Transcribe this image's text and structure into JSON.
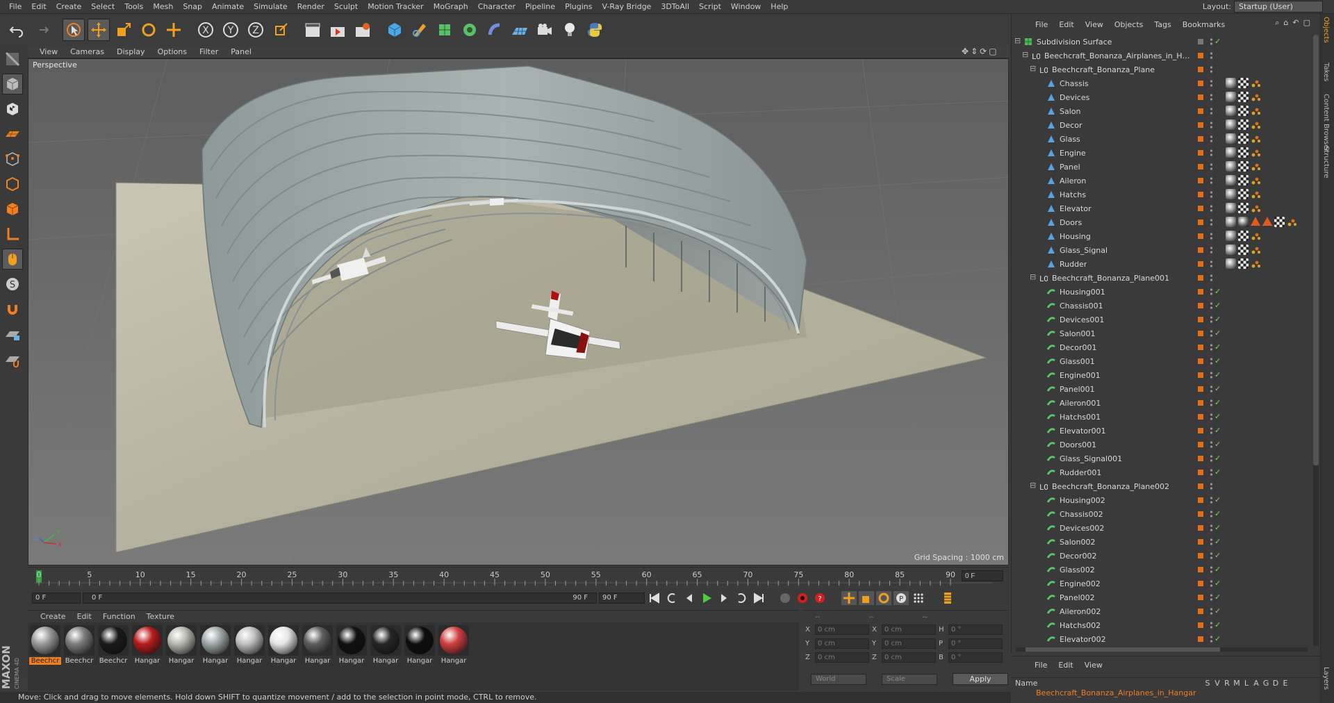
{
  "menu": [
    "File",
    "Edit",
    "Create",
    "Select",
    "Tools",
    "Mesh",
    "Snap",
    "Animate",
    "Simulate",
    "Render",
    "Sculpt",
    "Motion Tracker",
    "MoGraph",
    "Character",
    "Pipeline",
    "Plugins",
    "V-Ray Bridge",
    "3DToAll",
    "Script",
    "Window",
    "Help"
  ],
  "layout": {
    "label": "Layout:",
    "value": "Startup (User)"
  },
  "viewport": {
    "menu": [
      "View",
      "Cameras",
      "Display",
      "Options",
      "Filter",
      "Panel"
    ],
    "label": "Perspective",
    "grid_spacing": "Grid Spacing : 1000 cm"
  },
  "timeline": {
    "ticks": [
      "0",
      "5",
      "10",
      "15",
      "20",
      "25",
      "30",
      "35",
      "40",
      "45",
      "50",
      "55",
      "60",
      "65",
      "70",
      "75",
      "80",
      "85",
      "90"
    ],
    "current_frame": "0 F",
    "start": "0 F",
    "range_start": "0 F",
    "range_end": "90 F",
    "end": "90 F",
    "right_frame": "0 F"
  },
  "material_menu": [
    "Create",
    "Edit",
    "Function",
    "Texture"
  ],
  "materials": [
    {
      "label": "Beechcr",
      "color": "#9a9a9a",
      "selected": true
    },
    {
      "label": "Beechcr",
      "color": "#7d7d7d",
      "selected": false
    },
    {
      "label": "Beechcr",
      "color": "#1a1a1a",
      "selected": false
    },
    {
      "label": "Hangar",
      "color": "#b81c1c",
      "selected": false
    },
    {
      "label": "Hangar",
      "color": "#b8b8b0",
      "selected": false
    },
    {
      "label": "Hangar",
      "color": "#9fa8a8",
      "selected": false
    },
    {
      "label": "Hangar",
      "color": "#c0c0c0",
      "selected": false
    },
    {
      "label": "Hangar",
      "color": "#e6e6e6",
      "selected": false
    },
    {
      "label": "Hangar",
      "color": "#5e5e5e",
      "selected": false
    },
    {
      "label": "Hangar",
      "color": "#111111",
      "selected": false
    },
    {
      "label": "Hangar",
      "color": "#262626",
      "selected": false
    },
    {
      "label": "Hangar",
      "color": "#0d0d0d",
      "selected": false
    },
    {
      "label": "Hangar",
      "color": "#d04040",
      "selected": false
    }
  ],
  "coords": {
    "header": [
      "--",
      "--",
      "--"
    ],
    "rows": [
      {
        "a": "X",
        "av": "0 cm",
        "b": "X",
        "bv": "0 cm",
        "c": "H",
        "cv": "0 °"
      },
      {
        "a": "Y",
        "av": "0 cm",
        "b": "Y",
        "bv": "0 cm",
        "c": "P",
        "cv": "0 °"
      },
      {
        "a": "Z",
        "av": "0 cm",
        "b": "Z",
        "bv": "0 cm",
        "c": "B",
        "cv": "0 °"
      }
    ],
    "space": "World",
    "mode": "Scale",
    "apply": "Apply"
  },
  "status": "Move: Click and drag to move elements. Hold down SHIFT to quantize movement / add to the selection in point mode, CTRL to remove.",
  "object_menu": [
    "File",
    "Edit",
    "View",
    "Objects",
    "Tags",
    "Bookmarks"
  ],
  "objects": [
    {
      "name": "Subdivision Surface",
      "depth": 0,
      "kind": "sds"
    },
    {
      "name": "Beechcraft_Bonanza_Airplanes_in_Hangar",
      "depth": 1,
      "kind": "null"
    },
    {
      "name": "Beechcraft_Bonanza_Plane",
      "depth": 2,
      "kind": "null"
    },
    {
      "name": "Chassis",
      "depth": 3,
      "kind": "poly",
      "tags": 1
    },
    {
      "name": "Devices",
      "depth": 3,
      "kind": "poly",
      "tags": 1
    },
    {
      "name": "Salon",
      "depth": 3,
      "kind": "poly",
      "tags": 1
    },
    {
      "name": "Decor",
      "depth": 3,
      "kind": "poly",
      "tags": 1
    },
    {
      "name": "Glass",
      "depth": 3,
      "kind": "poly",
      "tags": 1
    },
    {
      "name": "Engine",
      "depth": 3,
      "kind": "poly",
      "tags": 1
    },
    {
      "name": "Panel",
      "depth": 3,
      "kind": "poly",
      "tags": 1
    },
    {
      "name": "Aileron",
      "depth": 3,
      "kind": "poly",
      "tags": 1
    },
    {
      "name": "Hatchs",
      "depth": 3,
      "kind": "poly",
      "tags": 1
    },
    {
      "name": "Elevator",
      "depth": 3,
      "kind": "poly",
      "tags": 1
    },
    {
      "name": "Doors",
      "depth": 3,
      "kind": "poly",
      "tags": 2
    },
    {
      "name": "Housing",
      "depth": 3,
      "kind": "poly",
      "tags": 1
    },
    {
      "name": "Glass_Signal",
      "depth": 3,
      "kind": "poly",
      "tags": 1
    },
    {
      "name": "Rudder",
      "depth": 3,
      "kind": "poly",
      "tags": 1
    },
    {
      "name": "Beechcraft_Bonanza_Plane001",
      "depth": 2,
      "kind": "null"
    },
    {
      "name": "Housing001",
      "depth": 3,
      "kind": "inst"
    },
    {
      "name": "Chassis001",
      "depth": 3,
      "kind": "inst"
    },
    {
      "name": "Devices001",
      "depth": 3,
      "kind": "inst"
    },
    {
      "name": "Salon001",
      "depth": 3,
      "kind": "inst"
    },
    {
      "name": "Decor001",
      "depth": 3,
      "kind": "inst"
    },
    {
      "name": "Glass001",
      "depth": 3,
      "kind": "inst"
    },
    {
      "name": "Engine001",
      "depth": 3,
      "kind": "inst"
    },
    {
      "name": "Panel001",
      "depth": 3,
      "kind": "inst"
    },
    {
      "name": "Aileron001",
      "depth": 3,
      "kind": "inst"
    },
    {
      "name": "Hatchs001",
      "depth": 3,
      "kind": "inst"
    },
    {
      "name": "Elevator001",
      "depth": 3,
      "kind": "inst"
    },
    {
      "name": "Doors001",
      "depth": 3,
      "kind": "inst"
    },
    {
      "name": "Glass_Signal001",
      "depth": 3,
      "kind": "inst"
    },
    {
      "name": "Rudder001",
      "depth": 3,
      "kind": "inst"
    },
    {
      "name": "Beechcraft_Bonanza_Plane002",
      "depth": 2,
      "kind": "null"
    },
    {
      "name": "Housing002",
      "depth": 3,
      "kind": "inst"
    },
    {
      "name": "Chassis002",
      "depth": 3,
      "kind": "inst"
    },
    {
      "name": "Devices002",
      "depth": 3,
      "kind": "inst"
    },
    {
      "name": "Salon002",
      "depth": 3,
      "kind": "inst"
    },
    {
      "name": "Decor002",
      "depth": 3,
      "kind": "inst"
    },
    {
      "name": "Glass002",
      "depth": 3,
      "kind": "inst"
    },
    {
      "name": "Engine002",
      "depth": 3,
      "kind": "inst"
    },
    {
      "name": "Panel002",
      "depth": 3,
      "kind": "inst"
    },
    {
      "name": "Aileron002",
      "depth": 3,
      "kind": "inst"
    },
    {
      "name": "Hatchs002",
      "depth": 3,
      "kind": "inst"
    },
    {
      "name": "Elevator002",
      "depth": 3,
      "kind": "inst"
    }
  ],
  "side_tabs": [
    "Objects",
    "Takes",
    "Content Browser",
    "Structure"
  ],
  "layers": {
    "menu": [
      "File",
      "Edit",
      "View"
    ],
    "columns": [
      "Name",
      "S",
      "V",
      "R",
      "M",
      "L",
      "A",
      "G",
      "D",
      "E"
    ],
    "row": "Beechcraft_Bonanza_Airplanes_in_Hangar",
    "side_tab": "Layers"
  },
  "colors": {
    "accent": "#f07f22",
    "check": "#7fd46b"
  }
}
